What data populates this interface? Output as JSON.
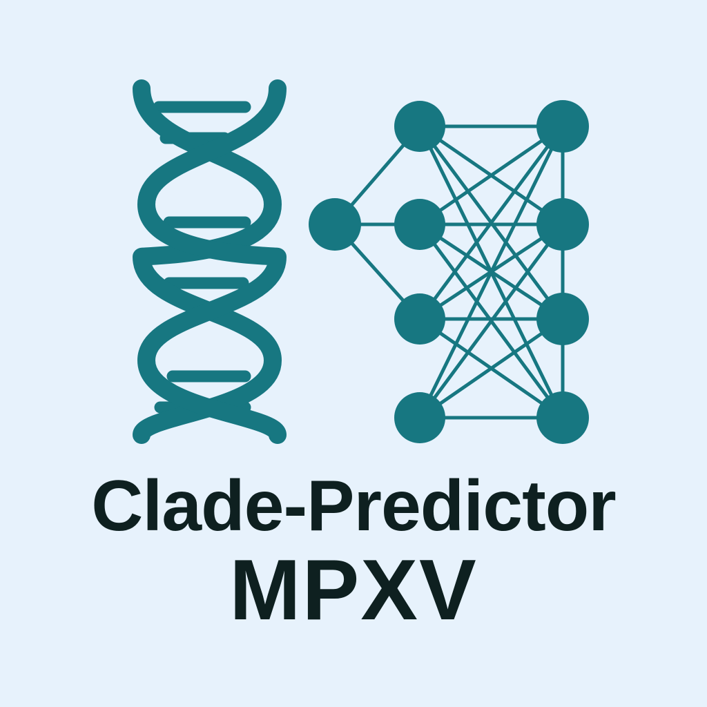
{
  "title": "Clade-Predictor",
  "subtitle": "MPXV",
  "colors": {
    "background": "#e7f2fc",
    "accent": "#177781",
    "text": "#0e2020"
  },
  "icons": [
    "dna-double-helix-icon",
    "neural-network-icon"
  ]
}
